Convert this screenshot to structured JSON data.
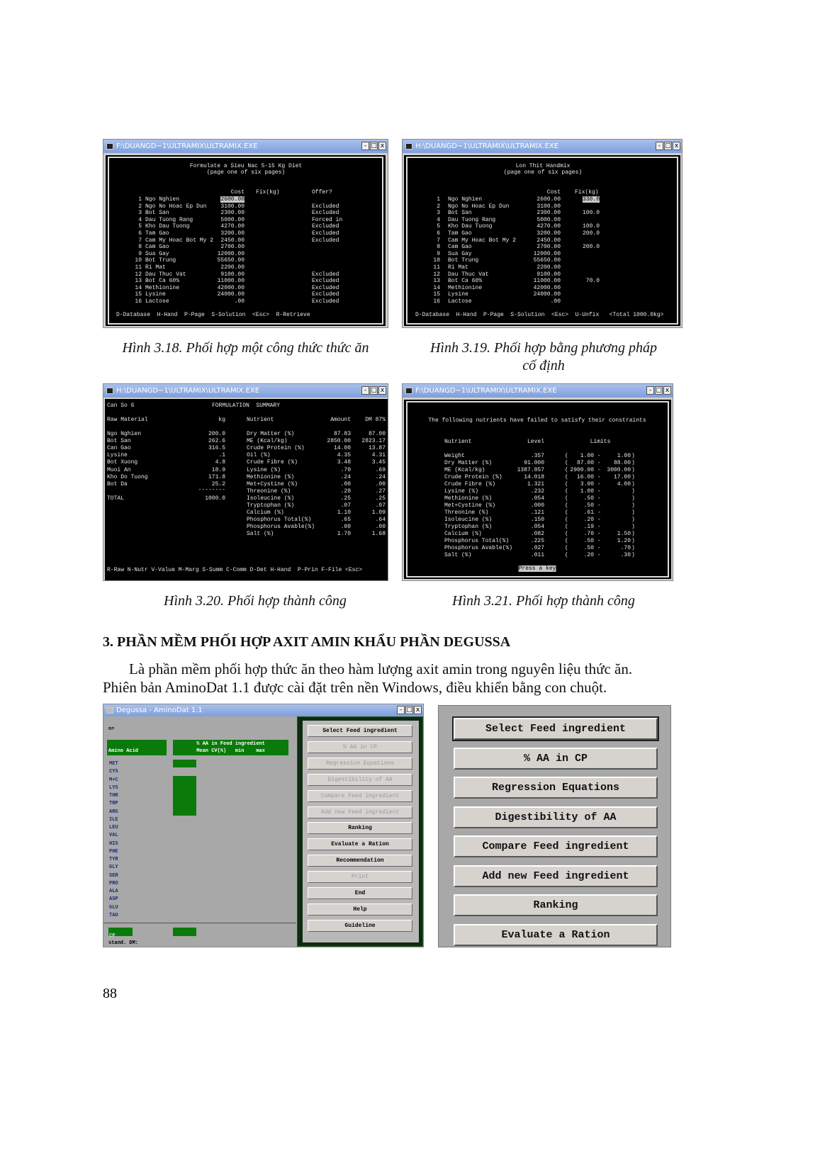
{
  "fig318": {
    "title": "F:\\DUANGD~1\\ULTRAMIX\\ULTRAMIX.EXE",
    "heading": "Formulate a Sieu Nac 5-15 Kg Diet",
    "sub": "(page one of six pages)",
    "headers": {
      "cost": "Cost",
      "fix": "Fix(kg)",
      "offer": "Offer?"
    },
    "rows": [
      [
        "1",
        "Ngo Nghien",
        "2600.00",
        ""
      ],
      [
        "2",
        "Ngo No Hoac Ep Dun",
        "3100.00",
        "Excluded"
      ],
      [
        "3",
        "Bot San",
        "2300.00",
        "Excluded"
      ],
      [
        "4",
        "Dau Tuong Rang",
        "5000.00",
        "Forced in"
      ],
      [
        "5",
        "Kho Dau Tuong",
        "4270.00",
        "Excluded"
      ],
      [
        "6",
        "Tam Gao",
        "3200.00",
        "Excluded"
      ],
      [
        "7",
        "Cam My Hoac Bot My 2",
        "2450.00",
        "Excluded"
      ],
      [
        "8",
        "Cam Gao",
        "2700.00",
        ""
      ],
      [
        "9",
        "Sua Gay",
        "12000.00",
        ""
      ],
      [
        "10",
        "Bot Trung",
        "55650.00",
        ""
      ],
      [
        "11",
        "Ri Mat",
        "2200.00",
        ""
      ],
      [
        "12",
        "Dau Thuc Vat",
        "9100.00",
        "Excluded"
      ],
      [
        "13",
        "Bot Ca 60%",
        "11000.00",
        "Excluded"
      ],
      [
        "14",
        "Methionine",
        "42000.00",
        "Excluded"
      ],
      [
        "15",
        "Lysine",
        "24000.00",
        "Excluded"
      ],
      [
        "16",
        "Lactose",
        ".00",
        "Excluded"
      ]
    ],
    "footer": "D-Database  H-Hand  P-Page  S-Solution  <Esc>  R-Retrieve",
    "caption": "Hình 3.18. Phối hợp một công thức thức ăn"
  },
  "fig319": {
    "title": "H:\\DUANGD~1\\ULTRAMIX\\ULTRAMIX.EXE",
    "heading": "Lon Thit Handmix",
    "sub": "(page one of six pages)",
    "headers": {
      "cost": "Cost",
      "fix": "Fix(kg)"
    },
    "rows": [
      [
        "1",
        "Ngo Nghien",
        "2600.00",
        "330.0"
      ],
      [
        "2",
        "Ngo No Hoac Ep Dun",
        "3100.00",
        ""
      ],
      [
        "3",
        "Bot San",
        "2300.00",
        "100.0"
      ],
      [
        "4",
        "Dau Tuong Rang",
        "5000.00",
        ""
      ],
      [
        "5",
        "Kho Dau Tuong",
        "4270.00",
        "100.0"
      ],
      [
        "6",
        "Tam Gao",
        "3200.00",
        "200.0"
      ],
      [
        "7",
        "Cam My Hoac Bot My 2",
        "2450.00",
        ""
      ],
      [
        "8",
        "Cam Gao",
        "2700.00",
        "200.0"
      ],
      [
        "9",
        "Sua Gay",
        "12000.00",
        ""
      ],
      [
        "10",
        "Bot Trung",
        "55650.00",
        ""
      ],
      [
        "11",
        "Ri Mat",
        "2200.00",
        ""
      ],
      [
        "12",
        "Dau Thuc Vat",
        "9100.00",
        ""
      ],
      [
        "13",
        "Bot Ca 60%",
        "11000.00",
        "70.0"
      ],
      [
        "14",
        "Methionine",
        "42000.00",
        ""
      ],
      [
        "15",
        "Lysine",
        "24000.00",
        ""
      ],
      [
        "16",
        "Lactose",
        ".00",
        ""
      ]
    ],
    "footer": "D-Database  H-Hand  P-Page  S-Solution  <Esc>  U-Unfix   <Total 1000.0kg>",
    "caption_l1": "Hình 3.19. Phối hợp bằng phương pháp",
    "caption_l2": "cố định"
  },
  "fig320": {
    "title": "H:\\DUANGD~1\\ULTRAMIX\\ULTRAMIX.EXE",
    "name": "Can So 6",
    "heading": "FORMULATION  SUMMARY",
    "headers": {
      "raw": "Raw Material",
      "kg": "kg",
      "nutrient": "Nutrient",
      "amount": "Amount",
      "dm": "DM 87%"
    },
    "materials": [
      [
        "Ngo Nghien",
        "200.0"
      ],
      [
        "Bot San",
        "262.6"
      ],
      [
        "Can Gao",
        "316.5"
      ],
      [
        "Lysine",
        ".1"
      ],
      [
        "Bot Xuong",
        "4.8"
      ],
      [
        "Muoi An",
        "18.9"
      ],
      [
        "Kho Do Tuong",
        "171.8"
      ],
      [
        "Bot Da",
        "25.2"
      ]
    ],
    "separator": "--------",
    "total_label": "TOTAL",
    "total": "1000.0",
    "nutrients": [
      [
        "Dry Matter (%)",
        "87.83",
        "87.00"
      ],
      [
        "ME (Kcal/kg)",
        "2850.00",
        "2823.17"
      ],
      [
        "Crude Protein (%)",
        "14.00",
        "13.87"
      ],
      [
        "Oil (%)",
        "4.35",
        "4.31"
      ],
      [
        "Crude Fibre (%)",
        "3.48",
        "3.45"
      ],
      [
        "Lysine (%)",
        ".70",
        ".69"
      ],
      [
        "Methionine (%)",
        ".24",
        ".24"
      ],
      [
        "Met+Cystine (%)",
        ".00",
        ".00"
      ],
      [
        "Threonine (%)",
        ".28",
        ".27"
      ],
      [
        "Isoleucine (%)",
        ".25",
        ".25"
      ],
      [
        "Tryptophan (%)",
        ".07",
        ".07"
      ],
      [
        "Calcium (%)",
        "1.10",
        "1.09"
      ],
      [
        "Phosphorus Total(%)",
        ".65",
        ".64"
      ],
      [
        "Phosphorus Avable(%)",
        ".00",
        ".00"
      ],
      [
        "Salt (%)",
        "1.70",
        "1.68"
      ]
    ],
    "footer": "R-Raw N-Nutr V-Value M-Marg S-Summ C-Comm D-Det H-Hand  P-Prin F-File <Esc>",
    "caption": "Hình 3.20. Phối hợp thành công"
  },
  "fig321": {
    "title": "F:\\DUANGD~1\\ULTRAMIX\\ULTRAMIX.EXE",
    "message": "The following nutrients have failed to satisfy their constraints",
    "headers": {
      "nutrient": "Nutrient",
      "level": "Level",
      "limits": "Limits"
    },
    "rows": [
      [
        "Weight",
        ".357",
        "1.00",
        "1.00"
      ],
      [
        "Dry Matter (%)",
        "91.000",
        "87.00",
        "88.00"
      ],
      [
        "ME (Kcal/kg)",
        "1387.857",
        "2900.00",
        "3000.00"
      ],
      [
        "Crude Protein (%)",
        "14.018",
        "16.00",
        "17.00"
      ],
      [
        "Crude Fibre (%)",
        "1.321",
        "3.00",
        "4.00"
      ],
      [
        "Lysine (%)",
        ".232",
        "1.00",
        ""
      ],
      [
        "Methionine (%)",
        ".054",
        ".50",
        ""
      ],
      [
        "Met+Cystine (%)",
        ".000",
        ".50",
        ""
      ],
      [
        "Threonine (%)",
        ".121",
        ".61",
        ""
      ],
      [
        "Isoleucine (%)",
        ".150",
        ".20",
        ""
      ],
      [
        "Tryptophan (%)",
        ".054",
        ".19",
        ""
      ],
      [
        "Calcium (%)",
        ".082",
        ".70",
        "1.50"
      ],
      [
        "Phosphorus Total(%)",
        ".225",
        ".50",
        "1.20"
      ],
      [
        "Phosphorus Avable(%)",
        ".027",
        ".50",
        ".70"
      ],
      [
        "Salt (%)",
        ".011",
        ".20",
        ".30"
      ]
    ],
    "press_key": "Press a key",
    "caption": "Hình 3.21. Phối hợp thành công"
  },
  "section": {
    "heading": "3. PHẦN MỀM PHỐI HỢP AXIT AMIN KHẨU PHẦN DEGUSSA",
    "para_l1": "Là phần mềm phối hợp thức ăn theo hàm lượng axit amin trong nguyên liệu thức ăn.",
    "para_l2": "Phiên bản AminoDat 1.1 được cài đặt trên nền Windows, điều khiển bằng con chuột."
  },
  "aminodat": {
    "title": "Degussa - AminoDat 1.1",
    "n_label": "n=",
    "aa_header": "Amino Acid",
    "feed_header": "% AA in Feed ingredient",
    "sub_header": "Mean CV(%)   min    max",
    "amino_acids": [
      "MET",
      "CYS",
      "M+C",
      "LYS",
      "THR",
      "TRP",
      "ARG",
      "ILE",
      "LEU",
      "VAL",
      "HIS",
      "PHE",
      "TYR",
      "GLY",
      "SER",
      "PRO",
      "ALA",
      "ASP",
      "GLU",
      "TAU"
    ],
    "cp_label": "CP",
    "stand_label": "stand. DM:",
    "buttons": [
      {
        "label": "Select Feed ingredient",
        "enabled": true
      },
      {
        "label": "% AA in CP",
        "enabled": false
      },
      {
        "label": "Regression Equations",
        "enabled": false
      },
      {
        "label": "Digestibility of AA",
        "enabled": false
      },
      {
        "label": "Compare Feed ingredient",
        "enabled": false
      },
      {
        "label": "Add new Feed ingredient",
        "enabled": false
      },
      {
        "label": "Ranking",
        "enabled": true
      },
      {
        "label": "Evaluate a Ration",
        "enabled": true
      },
      {
        "label": "Recommendation",
        "enabled": true
      },
      {
        "label": "Print",
        "enabled": false
      },
      {
        "label": "End",
        "enabled": true
      },
      {
        "label": "Help",
        "enabled": true
      },
      {
        "label": "Guideline",
        "enabled": true
      }
    ]
  },
  "menu_panel": {
    "buttons": [
      "Select Feed ingredient",
      "% AA in CP",
      "Regression Equations",
      "Digestibility of AA",
      "Compare Feed ingredient",
      "Add new Feed ingredient",
      "Ranking",
      "Evaluate a Ration"
    ]
  },
  "page_number": "88"
}
